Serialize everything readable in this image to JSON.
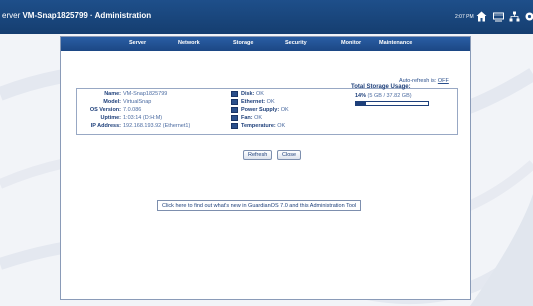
{
  "header": {
    "title_lead": "erver",
    "title": "VM-Snap1825799 · Administration",
    "clock": "2:07 PM",
    "icons": [
      "home-icon",
      "monitor-icon",
      "network-icon",
      "settings-icon"
    ]
  },
  "nav": {
    "items": [
      "Server",
      "Network",
      "Storage",
      "Security",
      "Monitor",
      "Maintenance"
    ]
  },
  "autorefresh": {
    "label": "Auto-refresh is:",
    "value": "OFF"
  },
  "system": {
    "name_label": "Name:",
    "name_value": "VM-Snap1825799",
    "model_label": "Model:",
    "model_value": "VirtualSnap",
    "os_label": "OS Version:",
    "os_value": "7.0.086",
    "uptime_label": "Uptime:",
    "uptime_value": "1:03:14 (D:H:M)",
    "ip_label": "IP Address:",
    "ip_value": "192.168.193.92 (Ethernet1)"
  },
  "status": {
    "disk_label": "Disk:",
    "disk_value": "OK",
    "ethernet_label": "Ethernet:",
    "ethernet_value": "OK",
    "power_label": "Power Supply:",
    "power_value": "OK",
    "fan_label": "Fan:",
    "fan_value": "OK",
    "temp_label": "Temperature:",
    "temp_value": "OK"
  },
  "storage": {
    "title": "Total Storage Usage:",
    "percent": "14%",
    "detail": "(5 GB / 37.82 GB)",
    "fraction": 0.14
  },
  "buttons": {
    "refresh": "Refresh",
    "close": "Close"
  },
  "whatsnew": "Click here to find out what's new in GuardianOS 7.0 and this Administration Tool"
}
